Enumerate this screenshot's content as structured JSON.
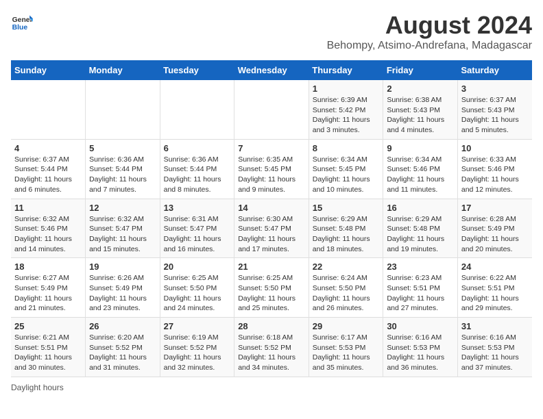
{
  "logo": {
    "line1": "General",
    "line2": "Blue"
  },
  "title": "August 2024",
  "subtitle": "Behompy, Atsimo-Andrefana, Madagascar",
  "weekdays": [
    "Sunday",
    "Monday",
    "Tuesday",
    "Wednesday",
    "Thursday",
    "Friday",
    "Saturday"
  ],
  "weeks": [
    [
      {
        "day": "",
        "info": ""
      },
      {
        "day": "",
        "info": ""
      },
      {
        "day": "",
        "info": ""
      },
      {
        "day": "",
        "info": ""
      },
      {
        "day": "1",
        "info": "Sunrise: 6:39 AM\nSunset: 5:42 PM\nDaylight: 11 hours and 3 minutes."
      },
      {
        "day": "2",
        "info": "Sunrise: 6:38 AM\nSunset: 5:43 PM\nDaylight: 11 hours and 4 minutes."
      },
      {
        "day": "3",
        "info": "Sunrise: 6:37 AM\nSunset: 5:43 PM\nDaylight: 11 hours and 5 minutes."
      }
    ],
    [
      {
        "day": "4",
        "info": "Sunrise: 6:37 AM\nSunset: 5:44 PM\nDaylight: 11 hours and 6 minutes."
      },
      {
        "day": "5",
        "info": "Sunrise: 6:36 AM\nSunset: 5:44 PM\nDaylight: 11 hours and 7 minutes."
      },
      {
        "day": "6",
        "info": "Sunrise: 6:36 AM\nSunset: 5:44 PM\nDaylight: 11 hours and 8 minutes."
      },
      {
        "day": "7",
        "info": "Sunrise: 6:35 AM\nSunset: 5:45 PM\nDaylight: 11 hours and 9 minutes."
      },
      {
        "day": "8",
        "info": "Sunrise: 6:34 AM\nSunset: 5:45 PM\nDaylight: 11 hours and 10 minutes."
      },
      {
        "day": "9",
        "info": "Sunrise: 6:34 AM\nSunset: 5:46 PM\nDaylight: 11 hours and 11 minutes."
      },
      {
        "day": "10",
        "info": "Sunrise: 6:33 AM\nSunset: 5:46 PM\nDaylight: 11 hours and 12 minutes."
      }
    ],
    [
      {
        "day": "11",
        "info": "Sunrise: 6:32 AM\nSunset: 5:46 PM\nDaylight: 11 hours and 14 minutes."
      },
      {
        "day": "12",
        "info": "Sunrise: 6:32 AM\nSunset: 5:47 PM\nDaylight: 11 hours and 15 minutes."
      },
      {
        "day": "13",
        "info": "Sunrise: 6:31 AM\nSunset: 5:47 PM\nDaylight: 11 hours and 16 minutes."
      },
      {
        "day": "14",
        "info": "Sunrise: 6:30 AM\nSunset: 5:47 PM\nDaylight: 11 hours and 17 minutes."
      },
      {
        "day": "15",
        "info": "Sunrise: 6:29 AM\nSunset: 5:48 PM\nDaylight: 11 hours and 18 minutes."
      },
      {
        "day": "16",
        "info": "Sunrise: 6:29 AM\nSunset: 5:48 PM\nDaylight: 11 hours and 19 minutes."
      },
      {
        "day": "17",
        "info": "Sunrise: 6:28 AM\nSunset: 5:49 PM\nDaylight: 11 hours and 20 minutes."
      }
    ],
    [
      {
        "day": "18",
        "info": "Sunrise: 6:27 AM\nSunset: 5:49 PM\nDaylight: 11 hours and 21 minutes."
      },
      {
        "day": "19",
        "info": "Sunrise: 6:26 AM\nSunset: 5:49 PM\nDaylight: 11 hours and 23 minutes."
      },
      {
        "day": "20",
        "info": "Sunrise: 6:25 AM\nSunset: 5:50 PM\nDaylight: 11 hours and 24 minutes."
      },
      {
        "day": "21",
        "info": "Sunrise: 6:25 AM\nSunset: 5:50 PM\nDaylight: 11 hours and 25 minutes."
      },
      {
        "day": "22",
        "info": "Sunrise: 6:24 AM\nSunset: 5:50 PM\nDaylight: 11 hours and 26 minutes."
      },
      {
        "day": "23",
        "info": "Sunrise: 6:23 AM\nSunset: 5:51 PM\nDaylight: 11 hours and 27 minutes."
      },
      {
        "day": "24",
        "info": "Sunrise: 6:22 AM\nSunset: 5:51 PM\nDaylight: 11 hours and 29 minutes."
      }
    ],
    [
      {
        "day": "25",
        "info": "Sunrise: 6:21 AM\nSunset: 5:51 PM\nDaylight: 11 hours and 30 minutes."
      },
      {
        "day": "26",
        "info": "Sunrise: 6:20 AM\nSunset: 5:52 PM\nDaylight: 11 hours and 31 minutes."
      },
      {
        "day": "27",
        "info": "Sunrise: 6:19 AM\nSunset: 5:52 PM\nDaylight: 11 hours and 32 minutes."
      },
      {
        "day": "28",
        "info": "Sunrise: 6:18 AM\nSunset: 5:52 PM\nDaylight: 11 hours and 34 minutes."
      },
      {
        "day": "29",
        "info": "Sunrise: 6:17 AM\nSunset: 5:53 PM\nDaylight: 11 hours and 35 minutes."
      },
      {
        "day": "30",
        "info": "Sunrise: 6:16 AM\nSunset: 5:53 PM\nDaylight: 11 hours and 36 minutes."
      },
      {
        "day": "31",
        "info": "Sunrise: 6:16 AM\nSunset: 5:53 PM\nDaylight: 11 hours and 37 minutes."
      }
    ]
  ],
  "footer": "Daylight hours"
}
